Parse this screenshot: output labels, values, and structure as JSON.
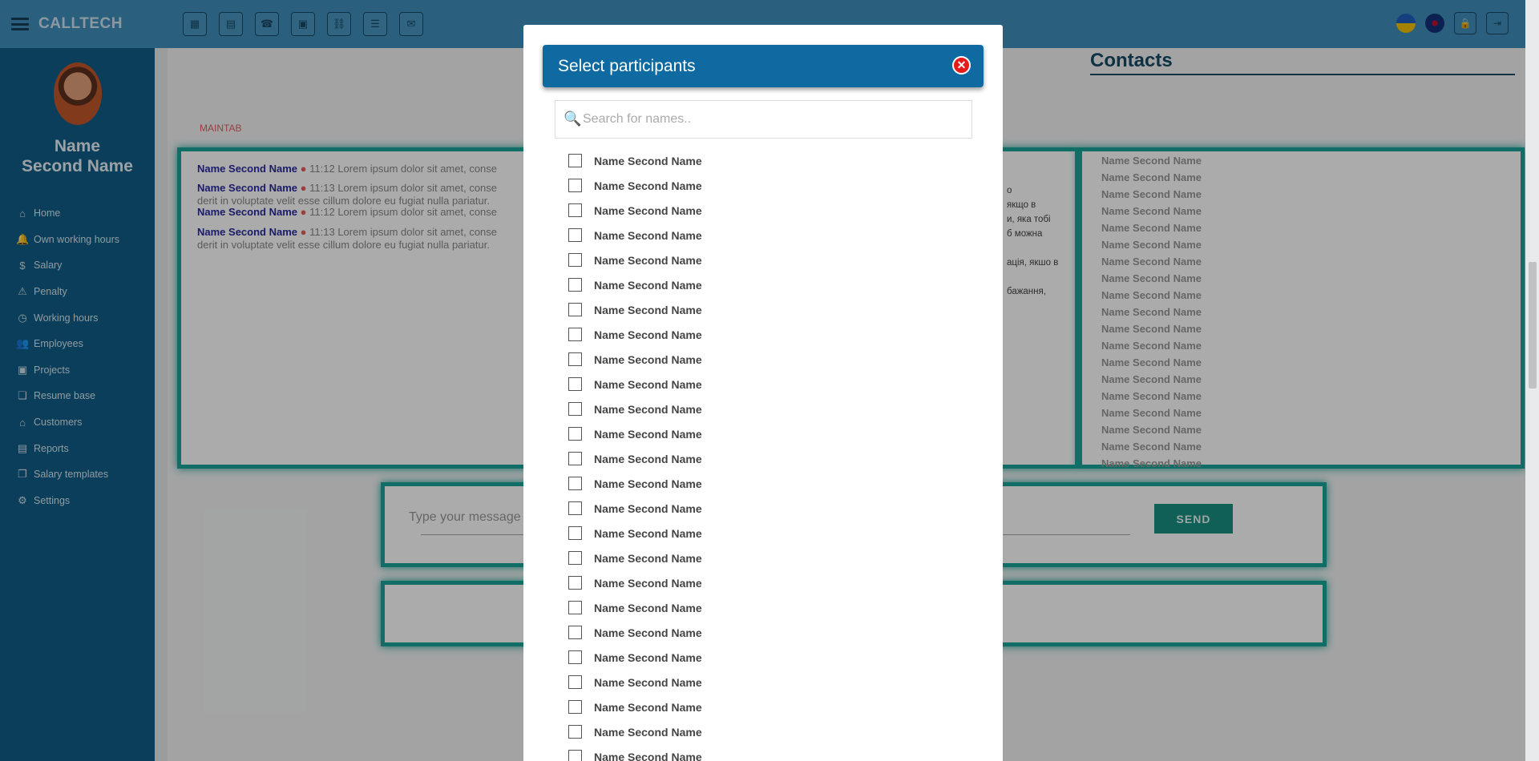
{
  "app": {
    "brand": "CALLTECH"
  },
  "toolbar": {
    "tools": [
      "calendar-icon",
      "table-icon",
      "phone-icon",
      "briefcase-icon",
      "link-icon",
      "list-icon",
      "comments-icon"
    ],
    "right": [
      "lock-icon",
      "logout-icon"
    ]
  },
  "user": {
    "first": "Name",
    "last": "Second Name"
  },
  "sidebar": {
    "items": [
      {
        "label": "Home",
        "icon": "⌂"
      },
      {
        "label": "Own working hours",
        "icon": "🔔"
      },
      {
        "label": "Salary",
        "icon": "$"
      },
      {
        "label": "Penalty",
        "icon": "⚠"
      },
      {
        "label": "Working hours",
        "icon": "◷"
      },
      {
        "label": "Employees",
        "icon": "👥"
      },
      {
        "label": "Projects",
        "icon": "▣"
      },
      {
        "label": "Resume base",
        "icon": "❏"
      },
      {
        "label": "Customers",
        "icon": "⌂"
      },
      {
        "label": "Reports",
        "icon": "▤"
      },
      {
        "label": "Salary templates",
        "icon": "❐"
      },
      {
        "label": "Settings",
        "icon": "⚙"
      }
    ]
  },
  "main": {
    "contacts_title": "Contacts",
    "tab_label": "MAINTAB",
    "messages": [
      {
        "name": "Name Second Name",
        "time": "11:12",
        "text": "Lorem ipsum dolor sit amet, conse",
        "text2": ""
      },
      {
        "name": "Name Second Name",
        "time": "11:13",
        "text": "Lorem ipsum dolor sit amet, conse",
        "text2": "derit in voluptate velit esse cillum dolore eu fugiat nulla pariatur."
      },
      {
        "name": "Name Second Name",
        "time": "11:12",
        "text": "Lorem ipsum dolor sit amet, conse",
        "text2": ""
      },
      {
        "name": "Name Second Name",
        "time": "11:13",
        "text": "Lorem ipsum dolor sit amet, conse",
        "text2": "derit in voluptate velit esse cillum dolore eu fugiat nulla pariatur."
      }
    ],
    "side_text": [
      "о",
      "якщо в",
      "и, яка тобі",
      "б можна",
      "",
      "ація, якшо в",
      "",
      "бажання,"
    ],
    "contacts": [
      "Name Second Name",
      "Name Second Name",
      "Name Second Name",
      "Name Second Name",
      "Name Second Name",
      "Name Second Name",
      "Name Second Name",
      "Name Second Name",
      "Name Second Name",
      "Name Second Name",
      "Name Second Name",
      "Name Second Name",
      "Name Second Name",
      "Name Second Name",
      "Name Second Name",
      "Name Second Name",
      "Name Second Name",
      "Name Second Name",
      "Name Second Name"
    ],
    "message_placeholder": "Type your message",
    "send_label": "SEND"
  },
  "modal": {
    "title": "Select participants",
    "search_placeholder": "Search for names..",
    "participants": [
      "Name Second Name",
      "Name Second Name",
      "Name Second Name",
      "Name Second Name",
      "Name Second Name",
      "Name Second Name",
      "Name Second Name",
      "Name Second Name",
      "Name Second Name",
      "Name Second Name",
      "Name Second Name",
      "Name Second Name",
      "Name Second Name",
      "Name Second Name",
      "Name Second Name",
      "Name Second Name",
      "Name Second Name",
      "Name Second Name",
      "Name Second Name",
      "Name Second Name",
      "Name Second Name",
      "Name Second Name",
      "Name Second Name",
      "Name Second Name",
      "Name Second Name"
    ]
  }
}
